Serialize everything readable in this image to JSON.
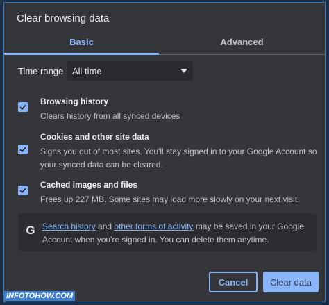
{
  "dialog": {
    "title": "Clear browsing data"
  },
  "tabs": [
    {
      "label": "Basic",
      "active": true
    },
    {
      "label": "Advanced",
      "active": false
    }
  ],
  "time_range": {
    "label": "Time range",
    "value": "All time"
  },
  "options": [
    {
      "title": "Browsing history",
      "description": "Clears history from all synced devices",
      "checked": true
    },
    {
      "title": "Cookies and other site data",
      "description": "Signs you out of most sites. You'll stay signed in to your Google Account so your synced data can be cleared.",
      "checked": true
    },
    {
      "title": "Cached images and files",
      "description": "Frees up 227 MB. Some sites may load more slowly on your next visit.",
      "checked": true
    }
  ],
  "info": {
    "icon": "google-g-icon",
    "link1": "Search history",
    "and": " and ",
    "link2": "other forms of activity",
    "rest": " may be saved in your Google Account when you're signed in. You can delete them anytime."
  },
  "buttons": {
    "cancel": "Cancel",
    "clear": "Clear data"
  },
  "watermark": "INFOTOHOW.COM",
  "colors": {
    "accent": "#8ab4f8",
    "background": "#35363a",
    "border": "#2a7fcf"
  }
}
